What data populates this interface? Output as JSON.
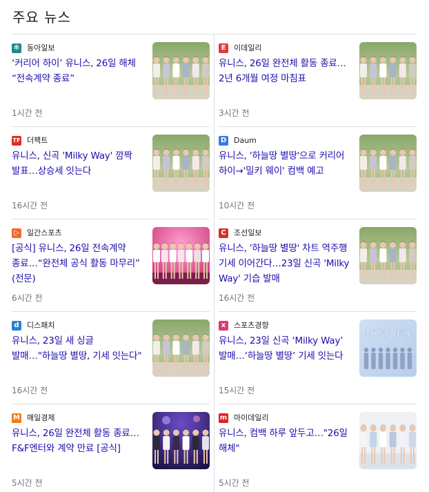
{
  "section": {
    "title": "주요 뉴스"
  },
  "cards": [
    {
      "source": "동아일보",
      "headline": "‘커리어 하이’ 유니스, 26일 해체 “전속계약 종료”",
      "time": "1시간 전",
      "logo_color": "#1c8a8a",
      "logo_glyph": "✻",
      "thumb": "group-photo"
    },
    {
      "source": "이데일리",
      "headline": "유니스, 26일 완전체 활동 종료… 2년 6개월 여정 마침표",
      "time": "3시간 전",
      "logo_color": "#e03a3e",
      "logo_glyph": "E",
      "thumb": "group-photo"
    },
    {
      "source": "더팩트",
      "headline": "유니스, 신곡 'Milky Way' 깜짝 발표…상승세 잇는다",
      "time": "16시간 전",
      "logo_color": "#d93025",
      "logo_glyph": "TF",
      "thumb": "group-photo"
    },
    {
      "source": "Daum",
      "headline": "유니스, '하늘땅 별땅'으로 커리어 하이→'밀키 웨이' 컴백 예고",
      "time": "10시간 전",
      "logo_color": "#3c7ae0",
      "logo_glyph": "D",
      "thumb": "group-photo"
    },
    {
      "source": "일간스포츠",
      "headline": "[공식] 유니스, 26일 전속계약 종료…“완전체 공식 활동 마무리” (전문)",
      "time": "6시간 전",
      "logo_color": "#f06a2a",
      "logo_glyph": "▷",
      "thumb": "stage-pink"
    },
    {
      "source": "조선일보",
      "headline": "유니스, '하늘땅 별땅' 차트 역주행 기세 이어간다…23일 신곡 'Milky Way' 기습 발매",
      "time": "16시간 전",
      "logo_color": "#d93025",
      "logo_glyph": "C",
      "thumb": "group-photo"
    },
    {
      "source": "디스패치",
      "headline": "유니스, 23일 새 싱글 발매…\"하늘땅 별땅, 기세 잇는다\"",
      "time": "16시간 전",
      "logo_color": "#2a7fd1",
      "logo_glyph": "d",
      "thumb": "group-photo"
    },
    {
      "source": "스포츠경향",
      "headline": "유니스, 23일 신곡 ‘Milky Way’ 발매…‘하늘땅 별땅’ 기세 잇는다",
      "time": "15시간 전",
      "logo_color": "#e0367a",
      "logo_glyph": "x",
      "thumb": "milky-way",
      "thumb_text": "Milky Way"
    },
    {
      "source": "매일경제",
      "headline": "유니스, 26일 완전체 활동 종료…F&F엔터와 계약 만료 [공식]",
      "time": "5시간 전",
      "logo_color": "#f07d16",
      "logo_glyph": "M",
      "thumb": "stage-purple"
    },
    {
      "source": "마이데일리",
      "headline": "유니스, 컴백 하루 앞두고…\"26일 해체\"",
      "time": "5시간 전",
      "logo_color": "#e02020",
      "logo_glyph": "m",
      "thumb": "group-light"
    }
  ]
}
